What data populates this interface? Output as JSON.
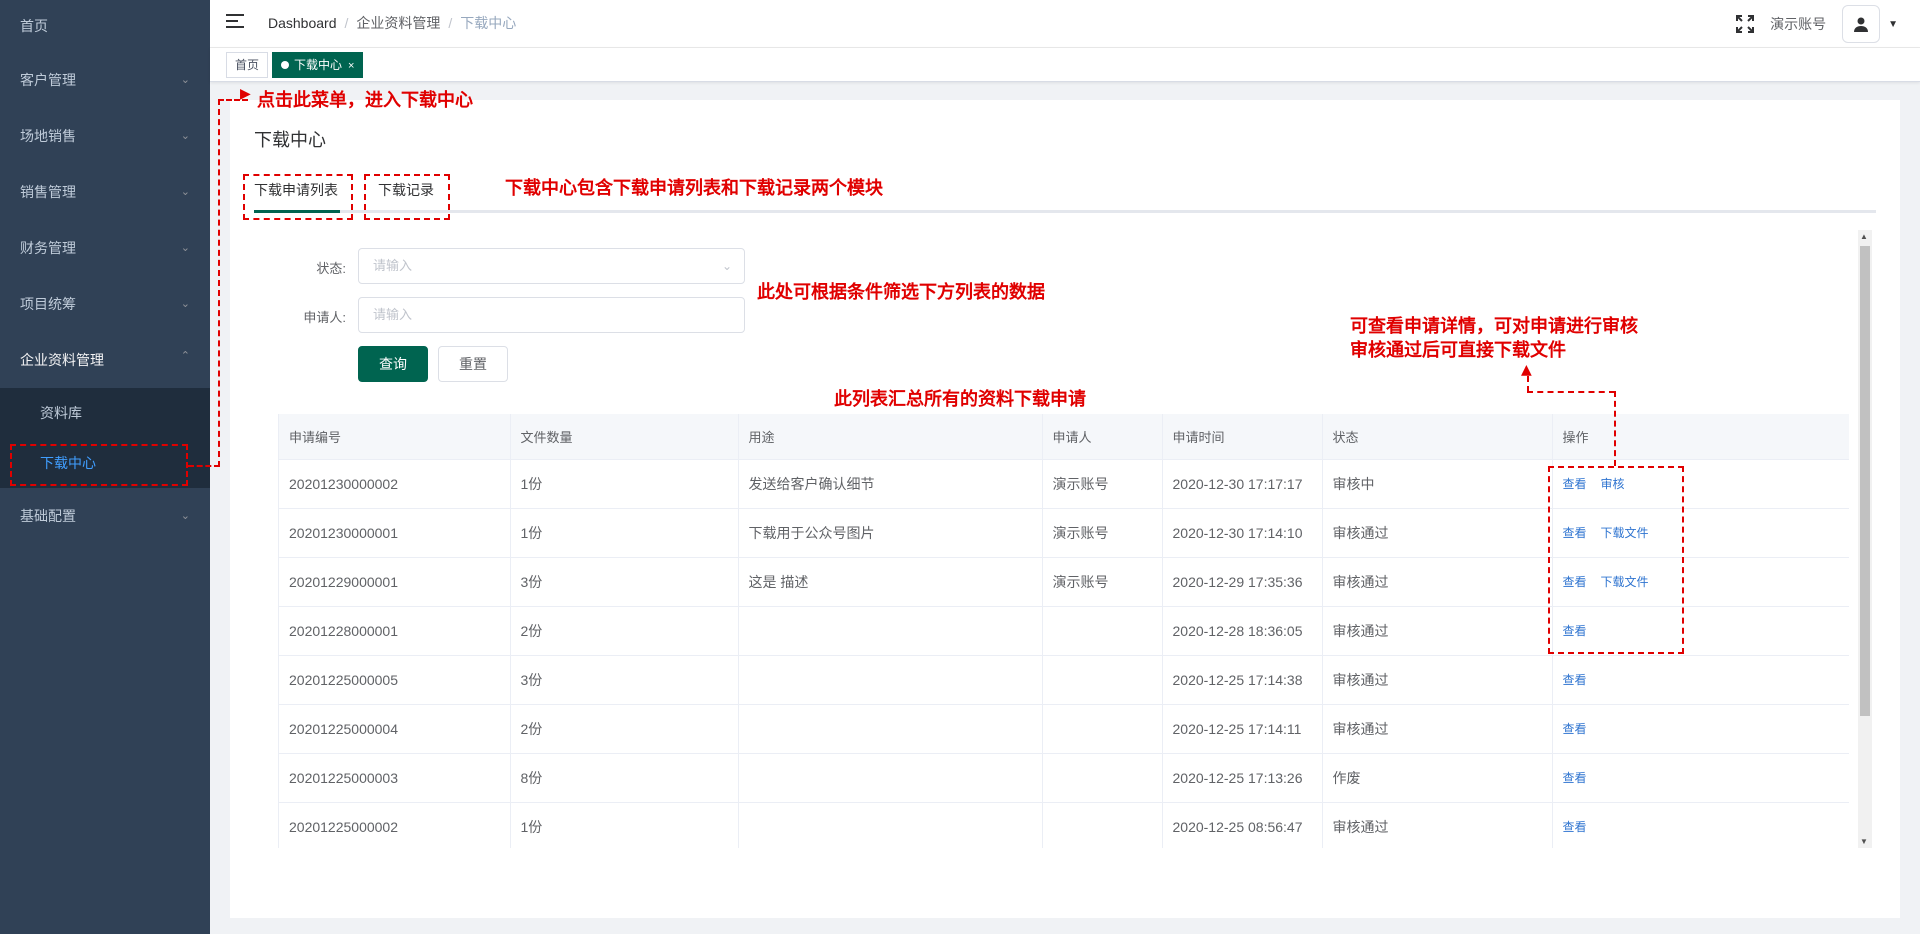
{
  "sidebar": {
    "items": [
      {
        "label": "首页"
      },
      {
        "label": "客户管理"
      },
      {
        "label": "场地销售"
      },
      {
        "label": "销售管理"
      },
      {
        "label": "财务管理"
      },
      {
        "label": "项目统筹"
      },
      {
        "label": "企业资料管理"
      },
      {
        "label": "资料库"
      },
      {
        "label": "下载中心"
      },
      {
        "label": "基础配置"
      }
    ]
  },
  "navbar": {
    "breadcrumb": [
      "Dashboard",
      "企业资料管理",
      "下载中心"
    ],
    "username": "演示账号"
  },
  "tags": {
    "home": "首页",
    "active": "下载中心"
  },
  "page": {
    "title": "下载中心",
    "tabs": [
      "下载申请列表",
      "下载记录"
    ]
  },
  "filters": {
    "status_label": "状态:",
    "status_placeholder": "请输入",
    "applicant_label": "申请人:",
    "applicant_placeholder": "请输入",
    "search_btn": "查询",
    "reset_btn": "重置"
  },
  "table": {
    "headers": [
      "申请编号",
      "文件数量",
      "用途",
      "申请人",
      "申请时间",
      "状态",
      "操作"
    ],
    "rows": [
      {
        "id": "20201230000002",
        "count": "1份",
        "purpose": "发送给客户确认细节",
        "applicant": "演示账号",
        "time": "2020-12-30 17:17:17",
        "status": "审核中",
        "actions": [
          "查看",
          "审核"
        ]
      },
      {
        "id": "20201230000001",
        "count": "1份",
        "purpose": "下载用于公众号图片",
        "applicant": "演示账号",
        "time": "2020-12-30 17:14:10",
        "status": "审核通过",
        "actions": [
          "查看",
          "下载文件"
        ]
      },
      {
        "id": "20201229000001",
        "count": "3份",
        "purpose": "这是                    描述",
        "applicant": "演示账号",
        "time": "2020-12-29 17:35:36",
        "status": "审核通过",
        "actions": [
          "查看",
          "下载文件"
        ]
      },
      {
        "id": "20201228000001",
        "count": "2份",
        "purpose": "",
        "applicant": "",
        "time": "2020-12-28 18:36:05",
        "status": "审核通过",
        "actions": [
          "查看"
        ]
      },
      {
        "id": "20201225000005",
        "count": "3份",
        "purpose": "",
        "applicant": "",
        "time": "2020-12-25 17:14:38",
        "status": "审核通过",
        "actions": [
          "查看"
        ]
      },
      {
        "id": "20201225000004",
        "count": "2份",
        "purpose": "",
        "applicant": "",
        "time": "2020-12-25 17:14:11",
        "status": "审核通过",
        "actions": [
          "查看"
        ]
      },
      {
        "id": "20201225000003",
        "count": "8份",
        "purpose": "",
        "applicant": "",
        "time": "2020-12-25 17:13:26",
        "status": "作废",
        "actions": [
          "查看"
        ]
      },
      {
        "id": "20201225000002",
        "count": "1份",
        "purpose": "",
        "applicant": "",
        "time": "2020-12-25 08:56:47",
        "status": "审核通过",
        "actions": [
          "查看"
        ]
      }
    ]
  },
  "annotations": {
    "menu_hint": "点击此菜单，进入下载中心",
    "tabs_hint": "下载中心包含下载申请列表和下载记录两个模块",
    "filter_hint": "此处可根据条件筛选下方列表的数据",
    "table_hint": "此列表汇总所有的资料下载申请",
    "action_hint_1": "可查看申请详情，可对申请进行审核",
    "action_hint_2": "审核通过后可直接下载文件"
  },
  "colors": {
    "sidebar_bg": "#304156",
    "primary": "#006450",
    "link": "#2f74d0",
    "annotation": "#e00000"
  }
}
